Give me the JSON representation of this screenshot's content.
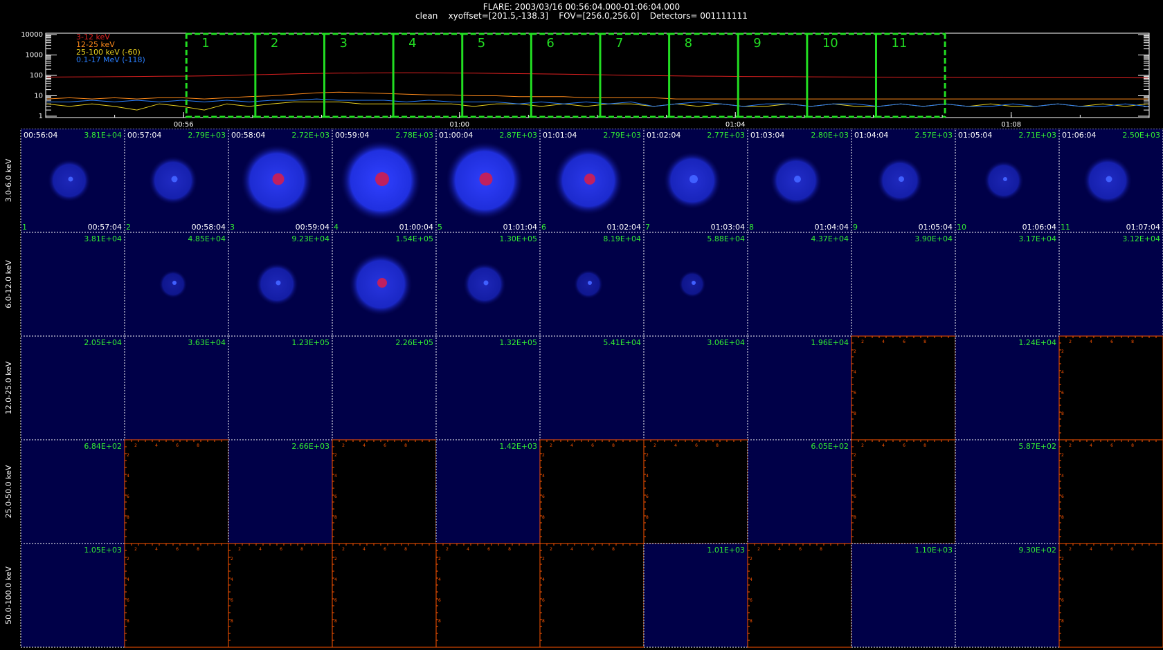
{
  "header": {
    "line1": "FLARE: 2003/03/16 00:56:04.000-01:06:04.000",
    "line2": "clean    xyoffset=[201.5,-138.3]    FOV=[256.0,256.0]    Detectors= 001111111"
  },
  "chart_data": [
    {
      "type": "line",
      "ylim": [
        1,
        10000
      ],
      "log_y": true,
      "y_ticks": [
        "1",
        "10",
        "100",
        "1000",
        "10000"
      ],
      "x_ticks": [
        "00:56",
        "01:00",
        "01:04",
        "01:08"
      ],
      "legend_placement": "top-left",
      "series": [
        {
          "name": "3-12 keV",
          "color": "#e02020",
          "values": [
            82,
            84,
            85,
            86,
            88,
            90,
            92,
            95,
            98,
            105,
            112,
            120,
            125,
            128,
            130,
            132,
            133,
            132,
            130,
            128,
            125,
            122,
            118,
            115,
            110,
            105,
            100,
            97,
            95,
            92,
            90,
            88,
            87,
            86,
            85,
            84,
            83,
            82,
            81,
            80,
            80,
            79,
            79,
            78,
            78,
            77,
            77,
            76,
            76,
            75
          ]
        },
        {
          "name": "12-25 keV",
          "color": "#ff8a1a",
          "values": [
            7,
            8,
            7,
            8,
            7,
            8,
            8,
            7,
            8,
            9,
            10,
            12,
            14,
            15,
            14,
            13,
            12,
            11,
            11,
            10,
            10,
            9,
            9,
            9,
            8,
            8,
            8,
            8,
            7,
            7,
            7,
            7,
            7,
            7,
            7,
            7,
            7,
            7,
            7,
            7,
            7,
            7,
            7,
            7,
            7,
            7,
            7,
            7,
            7,
            7
          ]
        },
        {
          "name": "25-100 keV (-60)",
          "color": "#e8d020",
          "values": [
            4,
            3,
            4,
            3,
            2,
            4,
            3,
            2,
            4,
            3,
            4,
            5,
            5,
            5,
            4,
            4,
            4,
            4,
            4,
            3,
            4,
            4,
            3,
            4,
            3,
            4,
            4,
            3,
            4,
            3,
            4,
            3,
            3,
            4,
            3,
            4,
            3,
            3,
            4,
            3,
            4,
            3,
            4,
            3,
            3,
            4,
            3,
            4,
            3,
            4
          ]
        },
        {
          "name": "0.1-17 MeV (-118)",
          "color": "#2a7fff",
          "values": [
            5,
            5,
            6,
            5,
            6,
            5,
            6,
            5,
            6,
            5,
            6,
            6,
            7,
            6,
            6,
            6,
            5,
            6,
            5,
            5,
            5,
            4,
            5,
            4,
            5,
            4,
            5,
            3,
            4,
            5,
            4,
            3,
            4,
            4,
            3,
            4,
            4,
            3,
            4,
            3,
            4,
            3,
            3,
            4,
            3,
            4,
            3,
            3,
            4,
            3
          ]
        }
      ],
      "intervals": [
        "1",
        "2",
        "3",
        "4",
        "5",
        "6",
        "7",
        "8",
        "9",
        "10",
        "11"
      ],
      "interval_color": "#22dd22"
    },
    {
      "type": "heatmap",
      "rows": [
        {
          "label": "3.0-6.0 keV",
          "cells": [
            {
              "t": "00:56:04",
              "peak": "3.81E+04",
              "n": "1",
              "t_end": "00:57:04",
              "img": 0.35
            },
            {
              "t": "00:57:04",
              "peak": "2.79E+03",
              "n": "2",
              "t_end": "00:58:04",
              "img": 0.45
            },
            {
              "t": "00:58:04",
              "peak": "2.72E+03",
              "n": "3",
              "t_end": "00:59:04",
              "img": 0.85
            },
            {
              "t": "00:59:04",
              "peak": "2.78E+03",
              "n": "4",
              "t_end": "01:00:04",
              "img": 1.0
            },
            {
              "t": "01:00:04",
              "peak": "2.87E+03",
              "n": "5",
              "t_end": "01:01:04",
              "img": 0.95
            },
            {
              "t": "01:01:04",
              "peak": "2.79E+03",
              "n": "6",
              "t_end": "01:02:04",
              "img": 0.8
            },
            {
              "t": "01:02:04",
              "peak": "2.77E+03",
              "n": "7",
              "t_end": "01:03:04",
              "img": 0.6
            },
            {
              "t": "01:03:04",
              "peak": "2.80E+03",
              "n": "8",
              "t_end": "01:04:04",
              "img": 0.5
            },
            {
              "t": "01:04:04",
              "peak": "2.57E+03",
              "n": "9",
              "t_end": "01:05:04",
              "img": 0.4
            },
            {
              "t": "01:05:04",
              "peak": "2.71E+03",
              "n": "10",
              "t_end": "01:06:04",
              "img": 0.3
            },
            {
              "t": "01:06:04",
              "peak": "2.50E+03",
              "n": "11",
              "t_end": "01:07:04",
              "img": 0.45
            }
          ]
        },
        {
          "label": "6.0-12.0 keV",
          "cells": [
            {
              "peak": "3.81E+04",
              "img": 0
            },
            {
              "peak": "4.85E+04",
              "img": 0.1
            },
            {
              "peak": "9.23E+04",
              "img": 0.35
            },
            {
              "peak": "1.54E+05",
              "img": 0.7
            },
            {
              "peak": "1.30E+05",
              "img": 0.35
            },
            {
              "peak": "8.19E+04",
              "img": 0.12
            },
            {
              "peak": "5.88E+04",
              "img": 0.08
            },
            {
              "peak": "4.37E+04",
              "img": 0
            },
            {
              "peak": "3.90E+04",
              "img": 0
            },
            {
              "peak": "3.17E+04",
              "img": 0
            },
            {
              "peak": "3.12E+04",
              "img": 0
            }
          ]
        },
        {
          "label": "12.0-25.0 keV",
          "cells": [
            {
              "peak": "2.05E+04"
            },
            {
              "peak": "3.63E+04"
            },
            {
              "peak": "1.23E+05"
            },
            {
              "peak": "2.26E+05"
            },
            {
              "peak": "1.32E+05"
            },
            {
              "peak": "5.41E+04"
            },
            {
              "peak": "3.06E+04"
            },
            {
              "peak": "1.96E+04"
            },
            {
              "peak": "",
              "empty": true
            },
            {
              "peak": "1.24E+04"
            },
            {
              "peak": "",
              "empty": true
            }
          ]
        },
        {
          "label": "25.0-50.0 keV",
          "cells": [
            {
              "peak": "6.84E+02"
            },
            {
              "peak": "",
              "empty": true
            },
            {
              "peak": "2.66E+03"
            },
            {
              "peak": "",
              "empty": true
            },
            {
              "peak": "1.42E+03"
            },
            {
              "peak": "",
              "empty": true
            },
            {
              "peak": "",
              "empty": true
            },
            {
              "peak": "6.05E+02"
            },
            {
              "peak": "",
              "empty": true
            },
            {
              "peak": "5.87E+02"
            },
            {
              "peak": "",
              "empty": true
            }
          ]
        },
        {
          "label": "50.0-100.0 keV",
          "cells": [
            {
              "peak": "1.05E+03"
            },
            {
              "peak": "",
              "empty": true
            },
            {
              "peak": "",
              "empty": true
            },
            {
              "peak": "",
              "empty": true
            },
            {
              "peak": "",
              "empty": true
            },
            {
              "peak": "",
              "empty": true
            },
            {
              "peak": "1.01E+03"
            },
            {
              "peak": "",
              "empty": true
            },
            {
              "peak": "1.10E+03"
            },
            {
              "peak": "9.30E+02"
            },
            {
              "peak": "",
              "empty": true
            }
          ]
        }
      ],
      "empty_axis_ticks": [
        "2",
        "4",
        "6",
        "8"
      ],
      "empty_axis_color": "#ff5500",
      "label_color": "#33ee33"
    }
  ]
}
